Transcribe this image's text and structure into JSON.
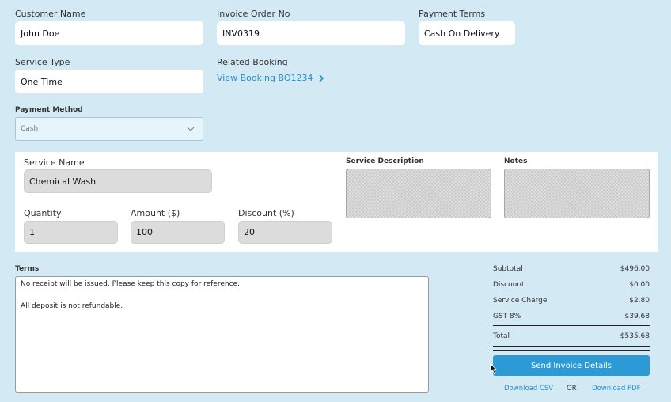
{
  "customer": {
    "label": "Customer Name",
    "value": "John Doe"
  },
  "invoice": {
    "label": "Invoice Order No",
    "value": "INV0319"
  },
  "terms_payment": {
    "label": "Payment Terms",
    "value": "Cash On Delivery"
  },
  "service_type": {
    "label": "Service Type",
    "value": "One Time"
  },
  "booking": {
    "label": "Related Booking",
    "link": "View Booking BO1234"
  },
  "payment_method": {
    "label": "Payment Method",
    "value": "Cash"
  },
  "service": {
    "name_label": "Service Name",
    "name_value": "Chemical Wash",
    "qty_label": "Quantity",
    "qty_value": "1",
    "amount_label": "Amount ($)",
    "amount_value": "100",
    "discount_label": "Discount (%)",
    "discount_value": "20",
    "desc_label": "Service Description",
    "notes_label": "Notes"
  },
  "terms": {
    "label": "Terms",
    "line1": "No receipt will be issued. Please keep this copy for reference.",
    "line2": "All deposit is not refundable."
  },
  "summary": {
    "subtotal_label": "Subtotal",
    "subtotal_value": "$496.00",
    "discount_label": "Discount",
    "discount_value": "$0.00",
    "service_charge_label": "Service Charge",
    "service_charge_value": "$2.80",
    "gst_label": "GST 8%",
    "gst_value": "$39.68",
    "total_label": "Total",
    "total_value": "$535.68"
  },
  "actions": {
    "send": "Send Invoice Details",
    "csv": "Download CSV",
    "or": "OR",
    "pdf": "Download PDF"
  },
  "colors": {
    "background": "#d3eaf5",
    "accent": "#2b9ad6",
    "link": "#2590cf"
  },
  "icons": {
    "booking_chevron": "chevron-right-icon",
    "select_chevron": "chevron-down-icon",
    "cursor": "mouse-pointer-icon"
  }
}
